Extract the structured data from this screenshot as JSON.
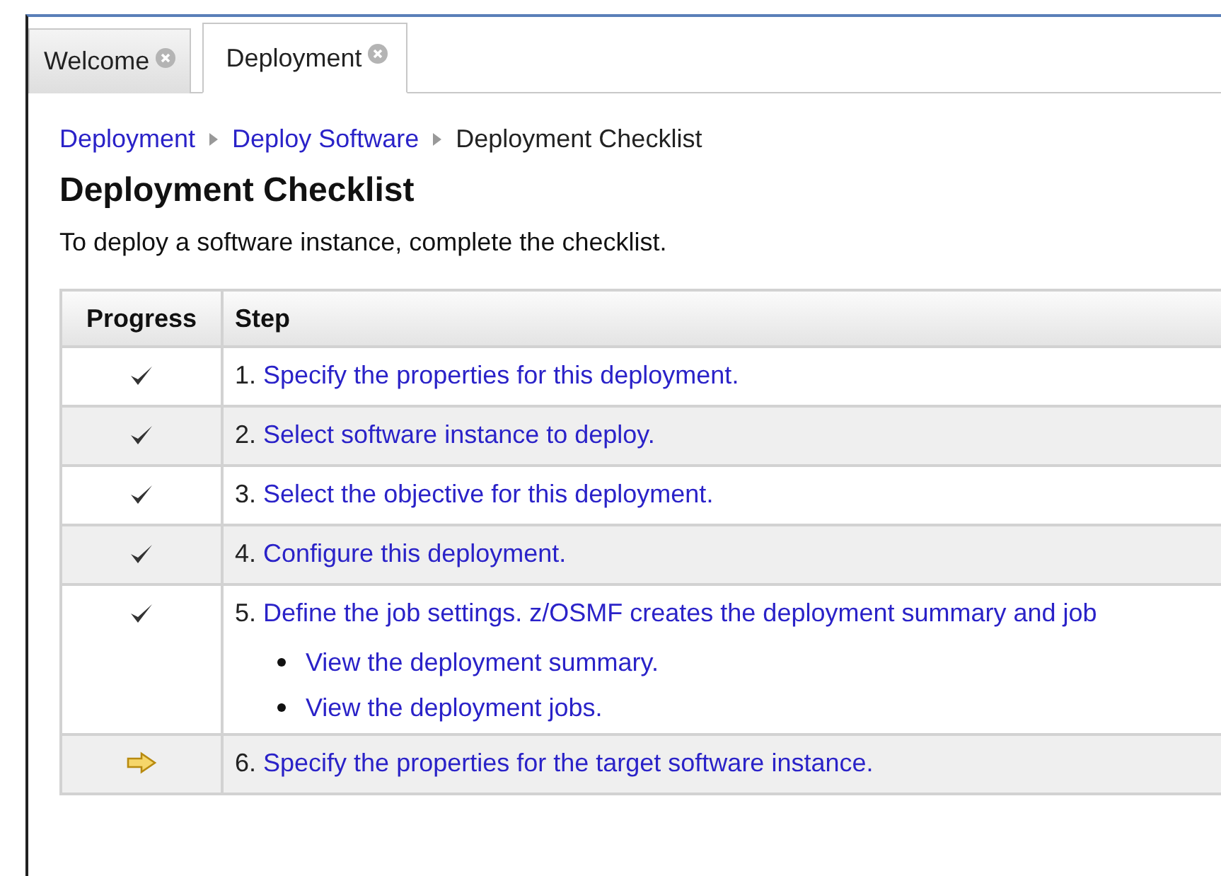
{
  "tabs": [
    {
      "label": "Welcome",
      "selected": false
    },
    {
      "label": "Deployment",
      "selected": true
    }
  ],
  "breadcrumb": [
    {
      "label": "Deployment",
      "link": true
    },
    {
      "label": "Deploy Software",
      "link": true
    },
    {
      "label": "Deployment Checklist",
      "link": false
    }
  ],
  "title": "Deployment Checklist",
  "intro": "To deploy a software instance, complete the checklist.",
  "table": {
    "columns": [
      "Progress",
      "Step"
    ],
    "rows": [
      {
        "kind": "done",
        "number": "1.",
        "text": "Specify the properties for this deployment."
      },
      {
        "kind": "done",
        "number": "2.",
        "text": "Select software instance to deploy."
      },
      {
        "kind": "done",
        "number": "3.",
        "text": "Select the objective for this deployment."
      },
      {
        "kind": "done",
        "number": "4.",
        "text": "Configure this deployment."
      },
      {
        "kind": "done",
        "number": "5.",
        "text": "Define the job settings. z/OSMF creates the deployment summary and job",
        "children": [
          "View the deployment summary.",
          "View the deployment jobs."
        ]
      },
      {
        "kind": "current",
        "number": "6.",
        "text": "Specify the properties for the target software instance."
      }
    ]
  }
}
